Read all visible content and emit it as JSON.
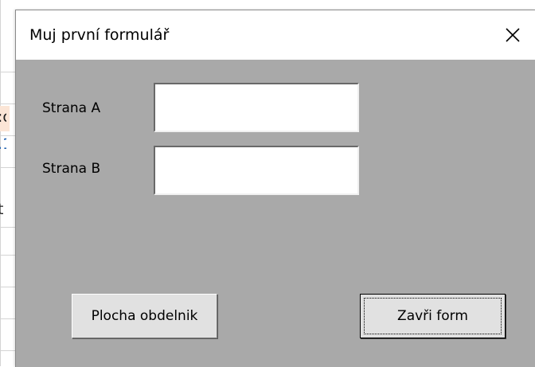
{
  "background_sheet": {
    "cell_fragments": [
      ":c",
      ".1",
      "t"
    ]
  },
  "dialog": {
    "title": "Muj první formulář",
    "close_icon": "close-x-icon",
    "fields": [
      {
        "label": "Strana A",
        "value": ""
      },
      {
        "label": "Strana B",
        "value": ""
      }
    ],
    "buttons": {
      "plocha": "Plocha obdelnik",
      "zavri": "Zavři form"
    }
  },
  "colors": {
    "dialog_background": "#a9a9a9",
    "titlebar_background": "#ffffff",
    "button_face": "#e1e1e1",
    "sheet_highlight": "#fbe5d6"
  }
}
